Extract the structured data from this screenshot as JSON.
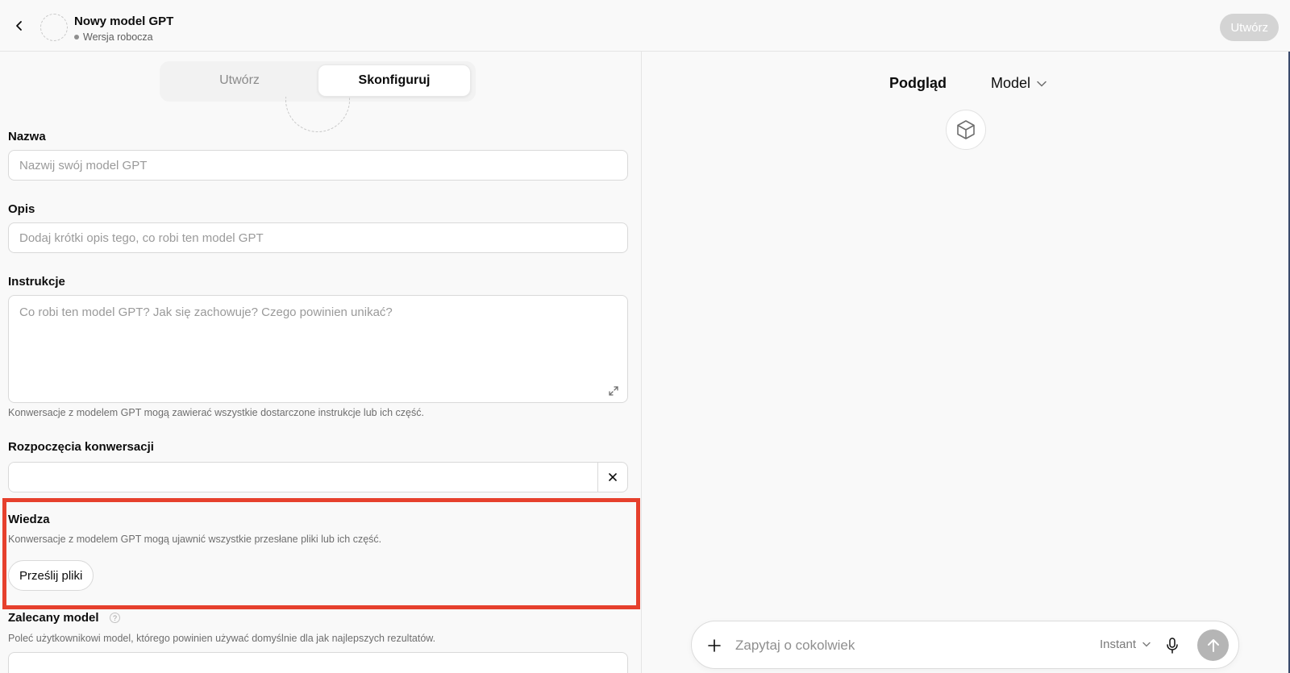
{
  "header": {
    "title": "Nowy model GPT",
    "status": "Wersja robocza",
    "create_button": "Utwórz"
  },
  "tabs": {
    "create": "Utwórz",
    "configure": "Skonfiguruj"
  },
  "form": {
    "name_label": "Nazwa",
    "name_placeholder": "Nazwij swój model GPT",
    "description_label": "Opis",
    "description_placeholder": "Dodaj krótki opis tego, co robi ten model GPT",
    "instructions_label": "Instrukcje",
    "instructions_placeholder": "Co robi ten model GPT? Jak się zachowuje? Czego powinien unikać?",
    "instructions_help": "Konwersacje z modelem GPT mogą zawierać wszystkie dostarczone instrukcje lub ich część.",
    "starters_label": "Rozpoczęcia konwersacji",
    "starter_value": "",
    "knowledge_label": "Wiedza",
    "knowledge_help": "Konwersacje z modelem GPT mogą ujawnić wszystkie przesłane pliki lub ich część.",
    "upload_button": "Prześlij pliki",
    "recommended_model_label": "Zalecany model",
    "recommended_model_help": "Poleć użytkownikowi model, którego powinien używać domyślnie dla jak najlepszych rezultatów."
  },
  "preview": {
    "title": "Podgląd",
    "model_dropdown": "Model",
    "composer_placeholder": "Zapytaj o cokolwiek",
    "mode": "Instant"
  },
  "colors": {
    "highlight": "#e6402d",
    "disabled_button": "#d4d4d4"
  }
}
